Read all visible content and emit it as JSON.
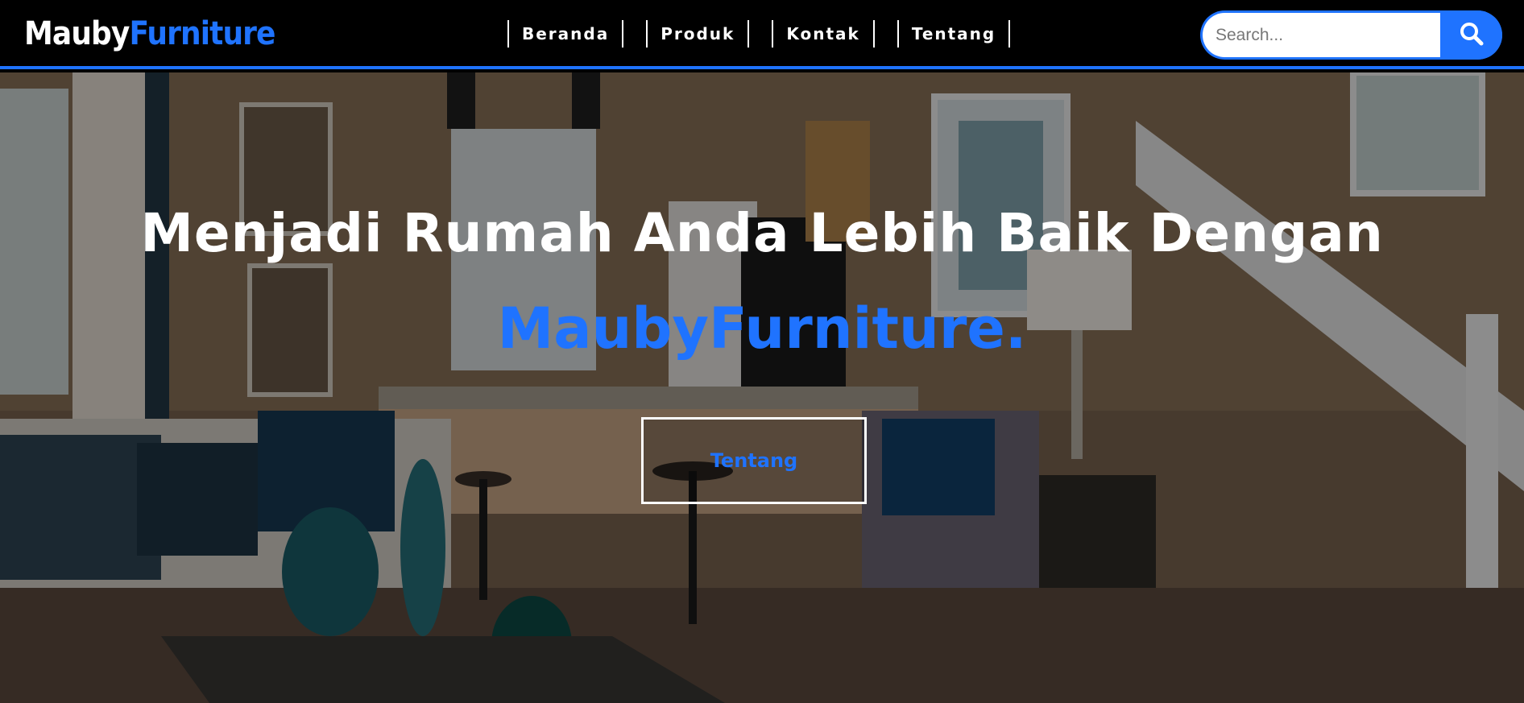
{
  "brand": {
    "part1": "Mauby",
    "part2": "Furniture"
  },
  "nav": {
    "items": [
      "Beranda",
      "Produk",
      "Kontak",
      "Tentang"
    ]
  },
  "search": {
    "placeholder": "Search...",
    "icon": "search-icon"
  },
  "hero": {
    "title": "Menjadi Rumah Anda Lebih Baik Dengan",
    "brand_line": "MaubyFurniture.",
    "button_label": "Tentang"
  },
  "colors": {
    "accent": "#1f73ff",
    "header_bg": "#000000",
    "text_light": "#ffffff"
  }
}
